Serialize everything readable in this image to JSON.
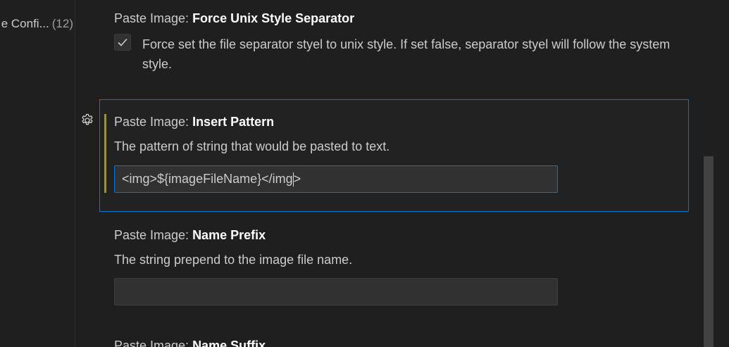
{
  "toc": {
    "item_label": "e Confi...",
    "item_count": "(12)"
  },
  "settings": [
    {
      "category": "Paste Image: ",
      "name": "Force Unix Style Separator",
      "checked": true,
      "description": "Force set the file separator styel to unix style. If set false, separator styel will follow the system style."
    },
    {
      "category": "Paste Image: ",
      "name": "Insert Pattern",
      "description": "The pattern of string that would be pasted to text.",
      "value_before_caret": "<img>${imageFileName}</img",
      "value_after_caret": ">",
      "modified": true
    },
    {
      "category": "Paste Image: ",
      "name": "Name Prefix",
      "description": "The string prepend to the image file name.",
      "value": ""
    },
    {
      "category": "Paste Image: ",
      "name": "Name Suffix"
    }
  ],
  "icons": {
    "checkbox_check": "check-icon",
    "manage": "gear-icon"
  },
  "colors": {
    "focus_border": "#0078d4",
    "modified_indicator": "#a08a4a"
  }
}
